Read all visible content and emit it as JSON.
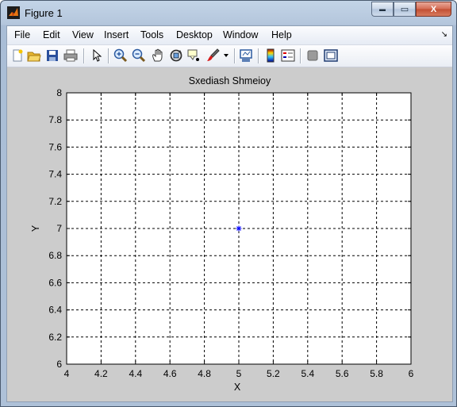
{
  "window": {
    "title": "Figure 1",
    "min_label": "▬",
    "max_label": "▭",
    "close_label": "X"
  },
  "menu": {
    "items": [
      "File",
      "Edit",
      "View",
      "Insert",
      "Tools",
      "Desktop",
      "Window",
      "Help"
    ],
    "overflow_arrow": "↘"
  },
  "toolbar": {
    "icons": [
      "new-figure",
      "open-file",
      "save-figure",
      "print-figure",
      "edit-plot",
      "zoom-in",
      "zoom-out",
      "pan",
      "rotate-3d",
      "data-cursor",
      "brush",
      "link-plot",
      "insert-colorbar",
      "insert-legend",
      "hide-plot-tools",
      "show-plot-tools"
    ]
  },
  "chart_data": {
    "type": "scatter",
    "title": "Sxediash Shmeioy",
    "xlabel": "X",
    "ylabel": "Y",
    "xlim": [
      4,
      6
    ],
    "ylim": [
      6,
      8
    ],
    "xticks": [
      "4",
      "4.2",
      "4.4",
      "4.6",
      "4.8",
      "5",
      "5.2",
      "5.4",
      "5.6",
      "5.8",
      "6"
    ],
    "yticks": [
      "6",
      "6.2",
      "6.4",
      "6.6",
      "6.8",
      "7",
      "7.2",
      "7.4",
      "7.6",
      "7.8",
      "8"
    ],
    "grid": true,
    "series": [
      {
        "marker": "*",
        "color": "#0000ff",
        "points": [
          [
            5,
            7
          ]
        ]
      }
    ]
  }
}
